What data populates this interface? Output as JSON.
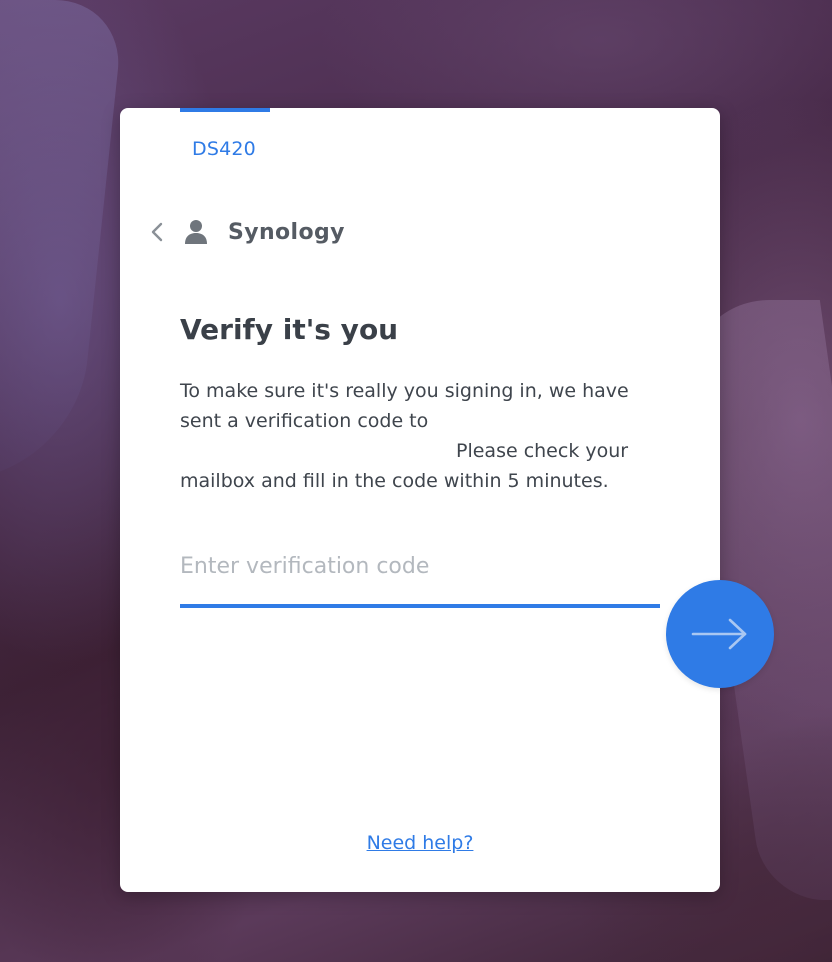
{
  "device": {
    "tab_label": "DS420"
  },
  "account": {
    "name": "Synology"
  },
  "verify": {
    "title": "Verify it's you",
    "description_lines": [
      "To make sure it's really you signing in, we have",
      "sent a verification code to",
      "Please check your",
      "mailbox and fill in the code within 5 minutes."
    ],
    "code_placeholder": "Enter verification code",
    "code_value": ""
  },
  "help": {
    "link_label": "Need help?"
  },
  "icons": {
    "back": "chevron-left-icon",
    "user": "user-icon",
    "next": "arrow-right-icon"
  },
  "colors": {
    "accent": "#2f7be6",
    "title": "#3a4048",
    "text": "#3f454d",
    "placeholder": "#b3b8be",
    "card": "#ffffff"
  }
}
